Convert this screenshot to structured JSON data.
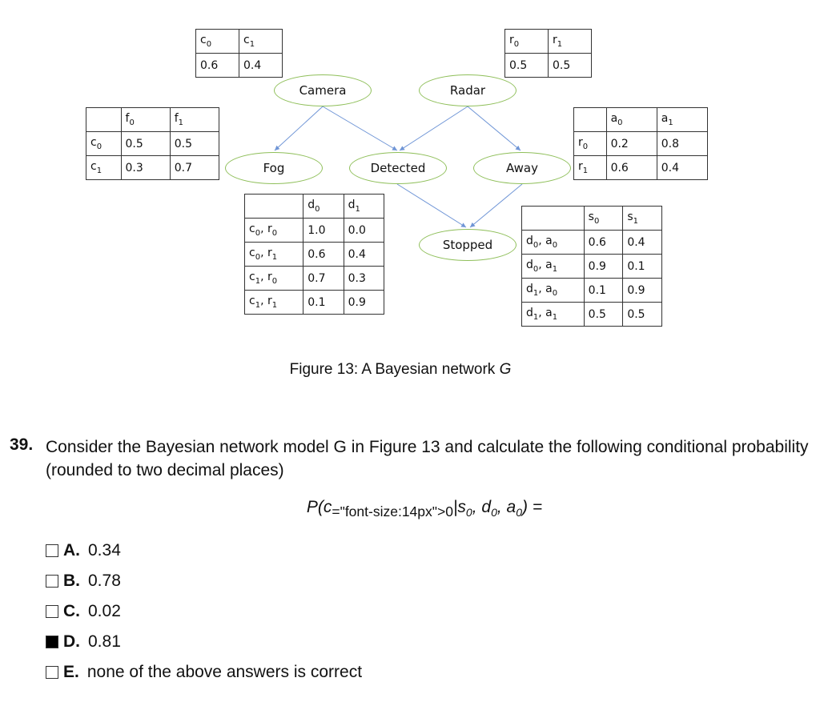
{
  "figure": {
    "caption_prefix": "Figure 13: A Bayesian network ",
    "caption_var": "G",
    "nodes": {
      "camera": "Camera",
      "radar": "Radar",
      "fog": "Fog",
      "detected": "Detected",
      "away": "Away",
      "stopped": "Stopped"
    },
    "edges": [
      [
        "Camera",
        "Fog"
      ],
      [
        "Camera",
        "Detected"
      ],
      [
        "Radar",
        "Detected"
      ],
      [
        "Radar",
        "Away"
      ],
      [
        "Detected",
        "Stopped"
      ],
      [
        "Away",
        "Stopped"
      ]
    ],
    "edge_color": "#6f95d6",
    "node_border_color": "#8fbf5a",
    "tables": {
      "camera": {
        "header": [
          "c0",
          "c1"
        ],
        "rows": [
          [
            "0.6",
            "0.4"
          ]
        ]
      },
      "radar": {
        "header": [
          "r0",
          "r1"
        ],
        "rows": [
          [
            "0.5",
            "0.5"
          ]
        ]
      },
      "fog": {
        "header": [
          "",
          "f0",
          "f1"
        ],
        "rows": [
          [
            "c0",
            "0.5",
            "0.5"
          ],
          [
            "c1",
            "0.3",
            "0.7"
          ]
        ]
      },
      "away": {
        "header": [
          "",
          "a0",
          "a1"
        ],
        "rows": [
          [
            "r0",
            "0.2",
            "0.8"
          ],
          [
            "r1",
            "0.6",
            "0.4"
          ]
        ]
      },
      "detected": {
        "header": [
          "",
          "d0",
          "d1"
        ],
        "rows": [
          [
            "c0, r0",
            "1.0",
            "0.0"
          ],
          [
            "c0, r1",
            "0.6",
            "0.4"
          ],
          [
            "c1, r0",
            "0.7",
            "0.3"
          ],
          [
            "c1, r1",
            "0.1",
            "0.9"
          ]
        ]
      },
      "stopped": {
        "header": [
          "",
          "s0",
          "s1"
        ],
        "rows": [
          [
            "d0, a0",
            "0.6",
            "0.4"
          ],
          [
            "d0, a1",
            "0.9",
            "0.1"
          ],
          [
            "d1, a0",
            "0.1",
            "0.9"
          ],
          [
            "d1, a1",
            "0.5",
            "0.5"
          ]
        ]
      }
    }
  },
  "question": {
    "number": "39.",
    "text": "Consider the Bayesian network model G in Figure 13 and calculate the following conditional probability (rounded to two decimal places)",
    "formula": "P(c0|s0, d0, a0) =",
    "options": [
      {
        "letter": "A.",
        "value": "0.34",
        "checked": false
      },
      {
        "letter": "B.",
        "value": "0.78",
        "checked": false
      },
      {
        "letter": "C.",
        "value": "0.02",
        "checked": false
      },
      {
        "letter": "D.",
        "value": "0.81",
        "checked": true
      },
      {
        "letter": "E.",
        "value": "none of the above answers is correct",
        "checked": false
      }
    ]
  }
}
